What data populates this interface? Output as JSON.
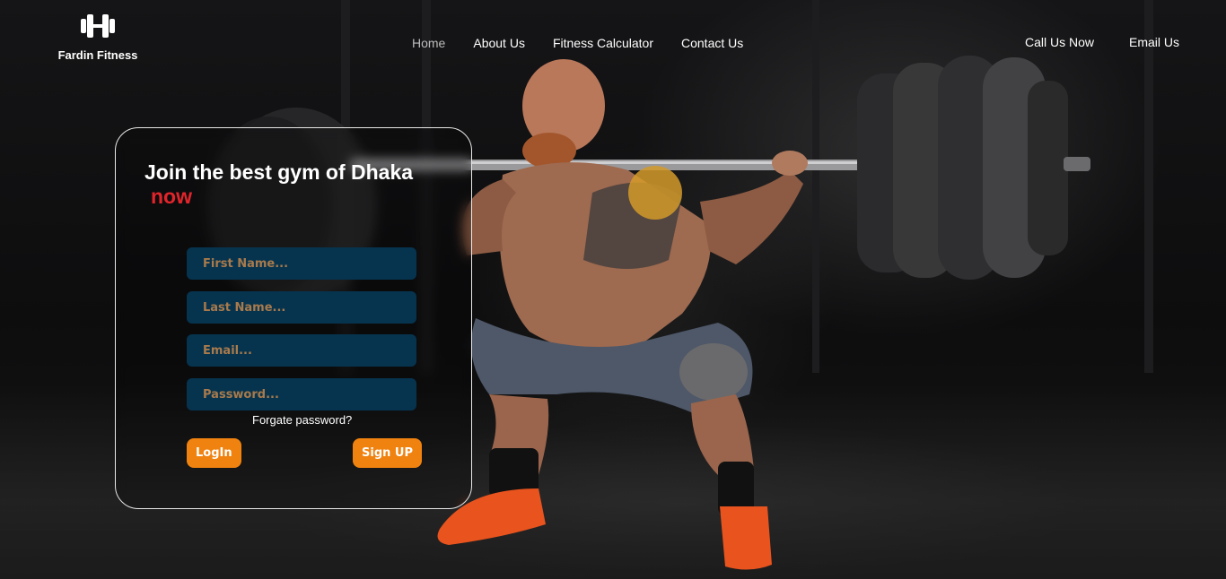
{
  "brand": {
    "name": "Fardin Fitness",
    "icon": "dumbbell-icon"
  },
  "nav": {
    "items": [
      {
        "label": "Home",
        "active": true
      },
      {
        "label": "About Us"
      },
      {
        "label": "Fitness Calculator"
      },
      {
        "label": "Contact Us"
      }
    ]
  },
  "contact": {
    "call": "Call Us Now",
    "email": "Email Us"
  },
  "form": {
    "heading": "Join the best gym of Dhaka",
    "heading_accent": "now",
    "first_name_placeholder": "First Name...",
    "last_name_placeholder": "Last Name...",
    "email_placeholder": "Email...",
    "password_placeholder": "Password...",
    "forgot_label": "Forgate password?",
    "login_label": "LogIn",
    "signup_label": "Sign UP"
  },
  "colors": {
    "accent": "#f0820f",
    "highlight": "#e3242b",
    "field_bg": "#06344f",
    "placeholder": "#a87a4c"
  }
}
